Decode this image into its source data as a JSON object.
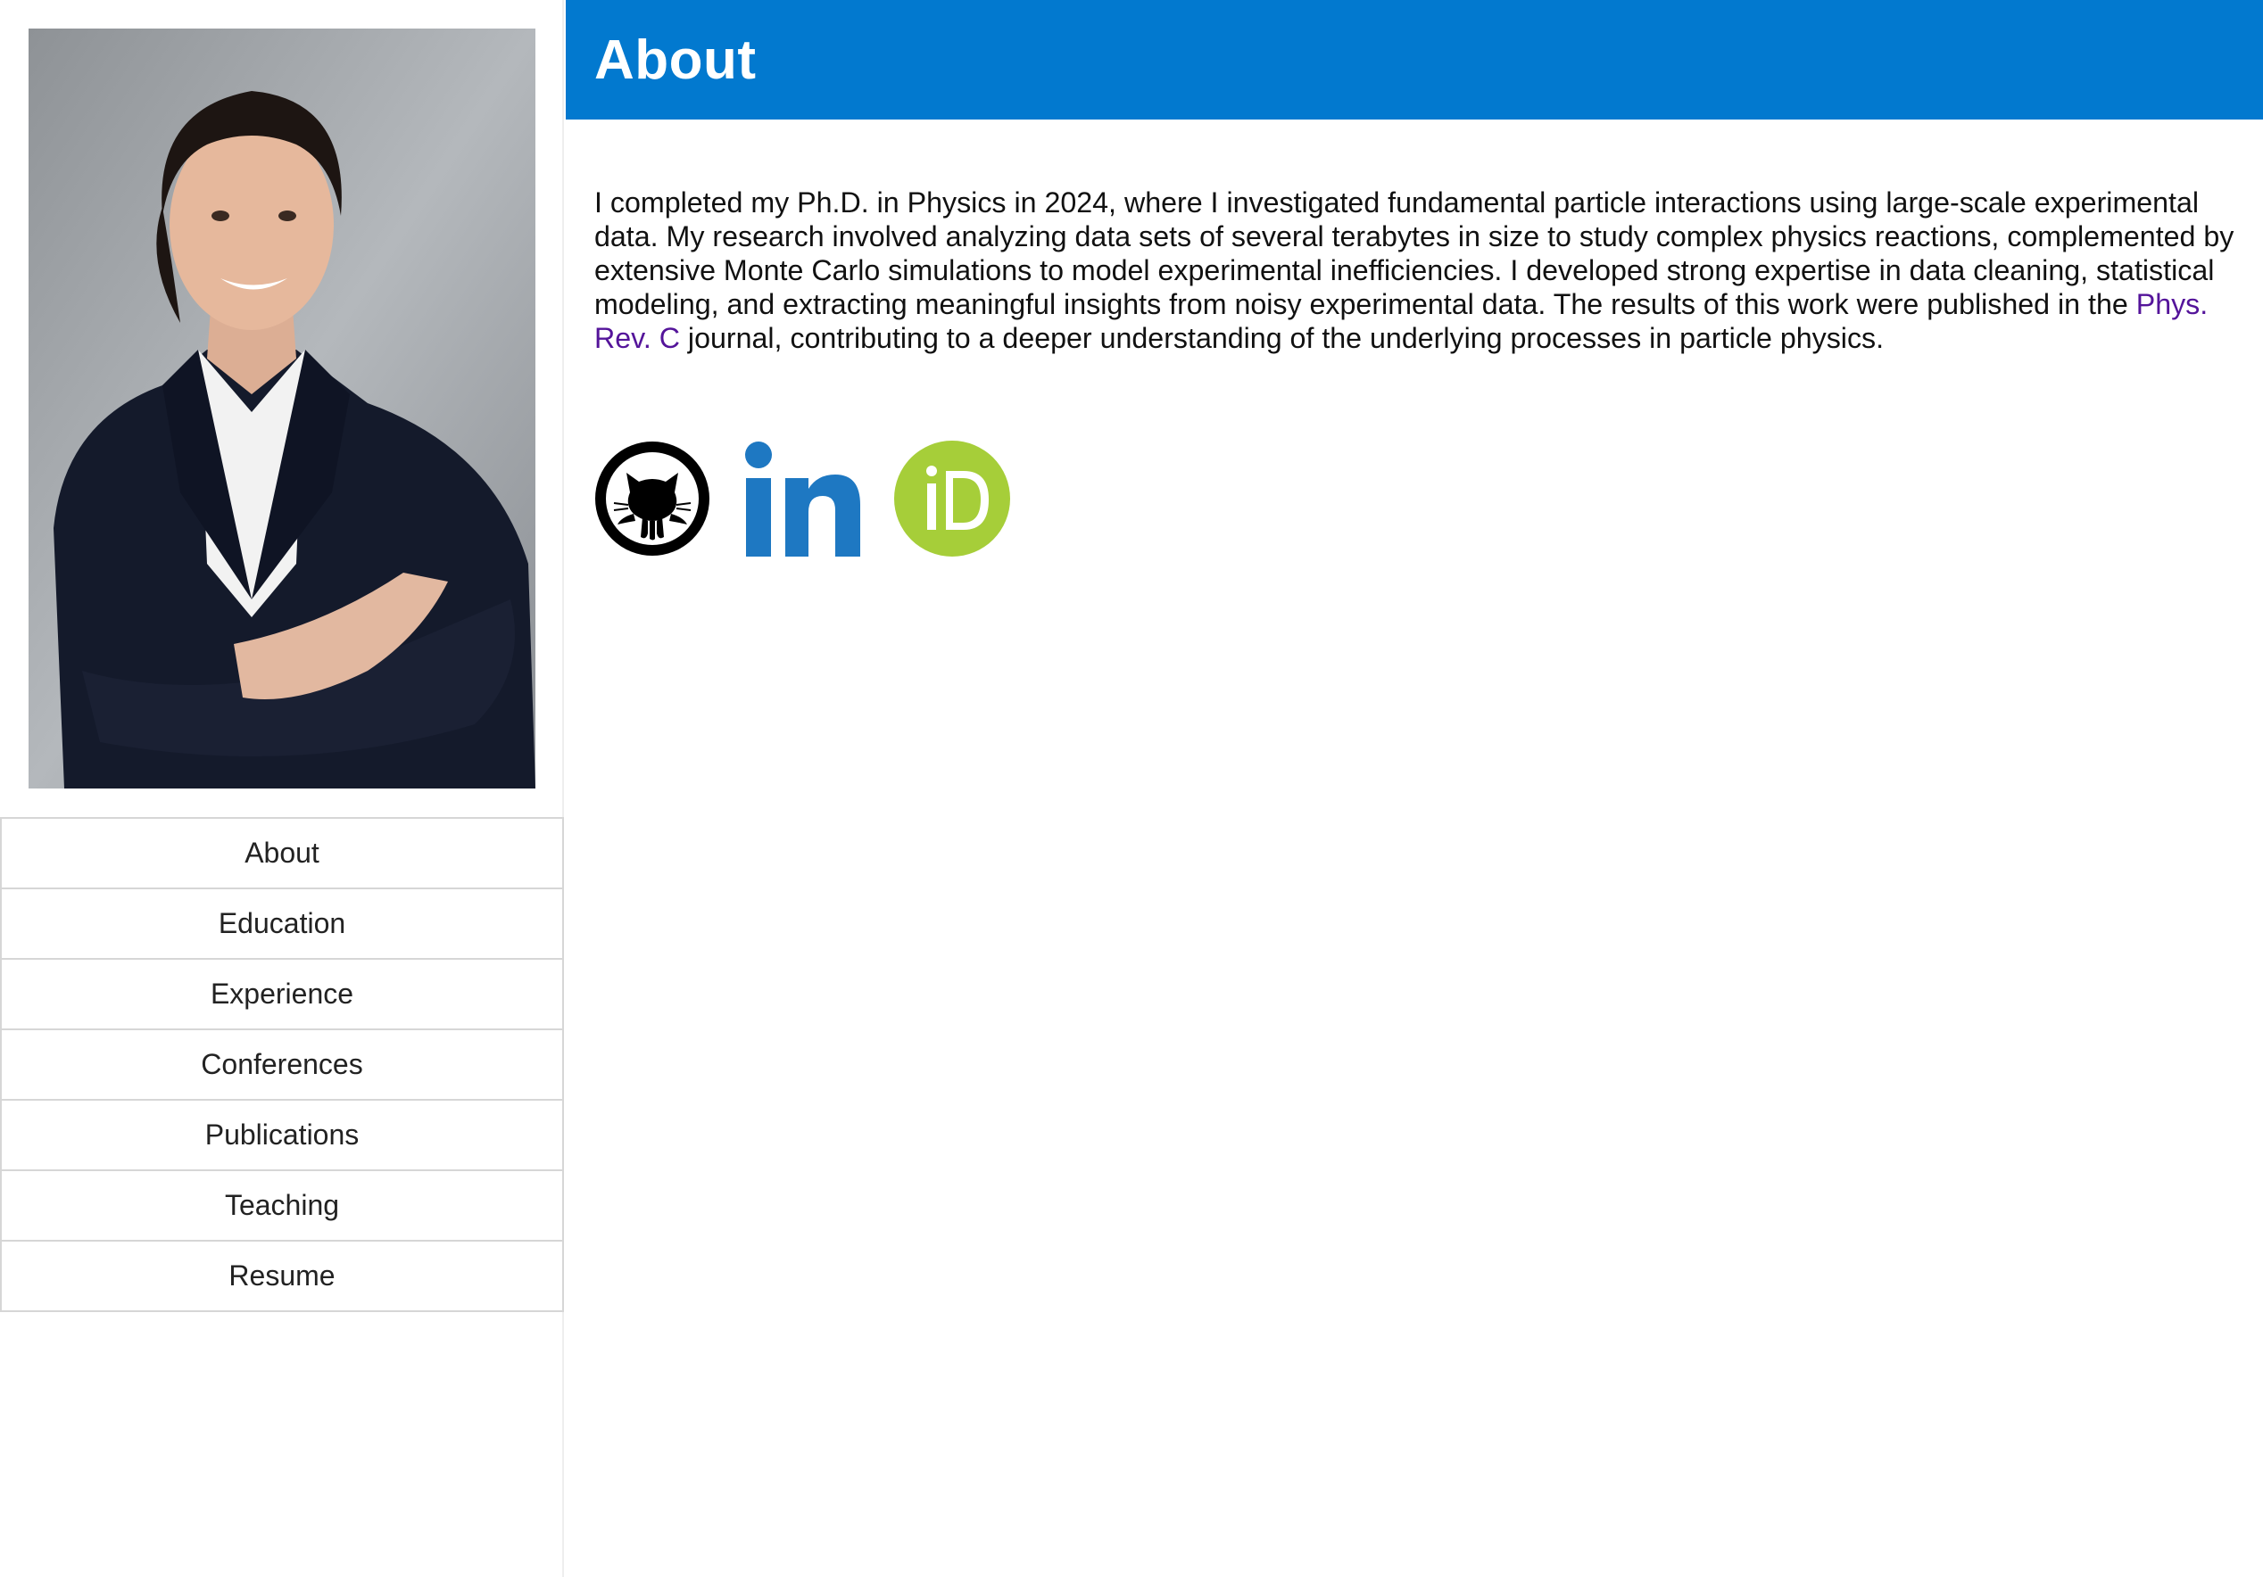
{
  "sidebar": {
    "photo_alt": "Profile photo",
    "nav": [
      {
        "label": "About"
      },
      {
        "label": "Education"
      },
      {
        "label": "Experience"
      },
      {
        "label": "Conferences"
      },
      {
        "label": "Publications"
      },
      {
        "label": "Teaching"
      },
      {
        "label": "Resume"
      }
    ]
  },
  "main": {
    "title": "About",
    "paragraph": {
      "before_link": "I completed my Ph.D. in Physics in 2024, where I investigated fundamental particle interactions using large-scale experimental data. My research involved analyzing data sets of several terabytes in size to study complex physics reactions, complemented by extensive Monte Carlo simulations to model experimental inefficiencies. I developed strong expertise in data cleaning, statistical modeling, and extracting meaningful insights from noisy experimental data. The results of this work were published in the ",
      "link_text": "Phys. Rev. C",
      "after_link": " journal, contributing to a deeper understanding of the underlying processes in particle physics."
    },
    "socials": [
      {
        "icon": "github-icon"
      },
      {
        "icon": "linkedin-icon"
      },
      {
        "icon": "orcid-icon"
      }
    ]
  },
  "colors": {
    "header_bg": "#0279cf",
    "link": "#54149a",
    "linkedin": "#1e78c2",
    "orcid": "#a6ce39"
  }
}
